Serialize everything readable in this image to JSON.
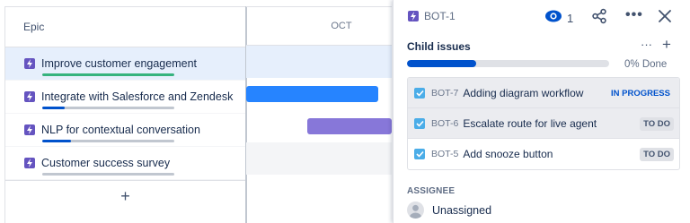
{
  "roadmap": {
    "epic_header": "Epic",
    "month_label": "OCT",
    "add_symbol": "+",
    "epics": [
      {
        "label": "Improve customer engagement",
        "progress": 1.0,
        "progress_color": "#36b37e",
        "selected": true
      },
      {
        "label": "Integrate with Salesforce and Zendesk",
        "progress": 0.17,
        "progress_color": "#0052cc",
        "selected": false
      },
      {
        "label": "NLP for contextual conversation",
        "progress": 0.22,
        "progress_color": "#0052cc",
        "selected": false
      },
      {
        "label": "Customer success survey",
        "progress": 0.0,
        "progress_color": "#0052cc",
        "selected": false
      }
    ],
    "timeline_bars": [
      {
        "row": 1,
        "color": "#2684ff"
      },
      {
        "row": 2,
        "color": "#8777d9"
      }
    ]
  },
  "panel": {
    "issue_key": "BOT-1",
    "watch_count": "1",
    "child_issues": {
      "title": "Child issues",
      "more_label": "···",
      "add_label": "+",
      "progress": 0.34,
      "progress_label": "0% Done",
      "items": [
        {
          "key": "BOT-7",
          "summary": "Adding diagram workflow",
          "status": "IN PROGRESS"
        },
        {
          "key": "BOT-6",
          "summary": "Escalate route for live agent",
          "status": "TO DO"
        },
        {
          "key": "BOT-5",
          "summary": "Add snooze button",
          "status": "TO DO"
        }
      ]
    },
    "assignee_label": "ASSIGNEE",
    "assignee_value": "Unassigned"
  },
  "colors": {
    "epic_purple": "#6554c0",
    "task_blue": "#4bade8",
    "brand_blue": "#0052cc",
    "selected_row": "#e6effc"
  },
  "icons": [
    "epic-icon",
    "eye-icon",
    "share-icon",
    "more-icon",
    "close-icon",
    "checkbox-icon",
    "avatar-icon"
  ]
}
